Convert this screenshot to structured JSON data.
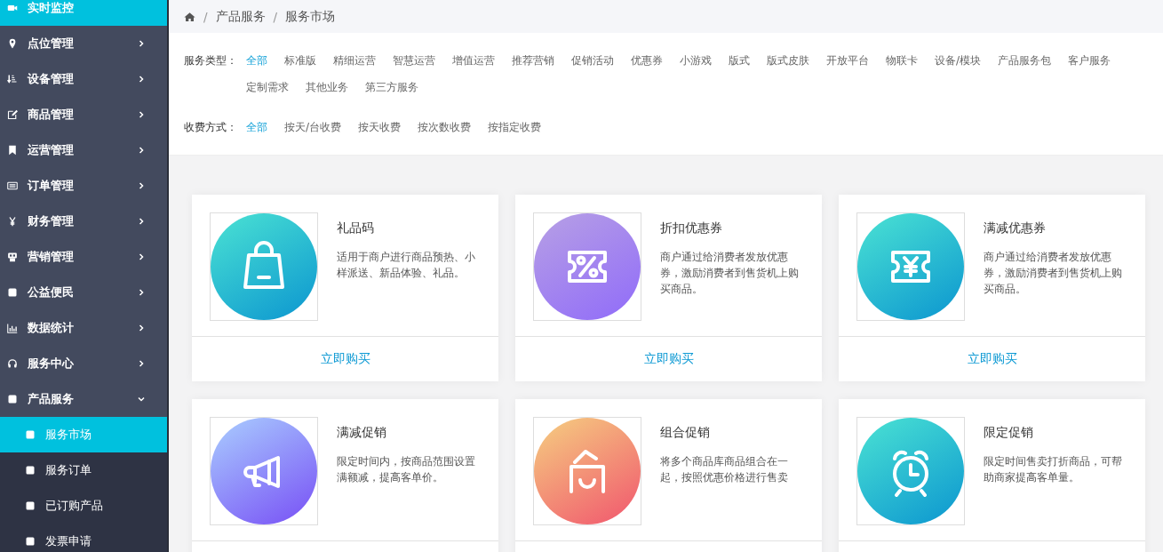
{
  "sidebar": {
    "items": [
      {
        "label": "实时监控",
        "selected": true
      },
      {
        "label": "点位管理",
        "selected": false,
        "expanded": false
      },
      {
        "label": "设备管理",
        "selected": false,
        "expanded": false
      },
      {
        "label": "商品管理",
        "selected": false,
        "expanded": false
      },
      {
        "label": "运营管理",
        "selected": false,
        "expanded": false
      },
      {
        "label": "订单管理",
        "selected": false,
        "expanded": false
      },
      {
        "label": "财务管理",
        "selected": false,
        "expanded": false
      },
      {
        "label": "营销管理",
        "selected": false,
        "expanded": false
      },
      {
        "label": "公益便民",
        "selected": false,
        "expanded": false
      },
      {
        "label": "数据统计",
        "selected": false,
        "expanded": false
      },
      {
        "label": "服务中心",
        "selected": false,
        "expanded": false
      },
      {
        "label": "产品服务",
        "selected": false,
        "expanded": true,
        "children": [
          {
            "label": "服务市场",
            "selected": true
          },
          {
            "label": "服务订单",
            "selected": false
          },
          {
            "label": "已订购产品",
            "selected": false
          },
          {
            "label": "发票申请",
            "selected": false
          }
        ]
      }
    ]
  },
  "breadcrumb": [
    {
      "separator": "/",
      "label": "产品服务"
    },
    {
      "separator": "/",
      "label": "服务市场"
    }
  ],
  "filters": [
    {
      "label": "服务类型：",
      "options": [
        {
          "label": "全部",
          "selected": true
        },
        {
          "label": "标准版",
          "selected": false
        },
        {
          "label": "精细运营",
          "selected": false
        },
        {
          "label": "智慧运营",
          "selected": false
        },
        {
          "label": "增值运营",
          "selected": false
        },
        {
          "label": "推荐营销",
          "selected": false
        },
        {
          "label": "促销活动",
          "selected": false
        },
        {
          "label": "优惠券",
          "selected": false
        },
        {
          "label": "小游戏",
          "selected": false
        },
        {
          "label": "版式",
          "selected": false
        },
        {
          "label": "版式皮肤",
          "selected": false
        },
        {
          "label": "开放平台",
          "selected": false
        },
        {
          "label": "物联卡",
          "selected": false
        },
        {
          "label": "设备/模块",
          "selected": false
        },
        {
          "label": "产品服务包",
          "selected": false
        },
        {
          "label": "客户服务",
          "selected": false
        },
        {
          "label": "定制需求",
          "selected": false
        },
        {
          "label": "其他业务",
          "selected": false
        },
        {
          "label": "第三方服务",
          "selected": false
        }
      ]
    },
    {
      "label": "收费方式：",
      "options": [
        {
          "label": "全部",
          "selected": true
        },
        {
          "label": "按天/台收费",
          "selected": false
        },
        {
          "label": "按天收费",
          "selected": false
        },
        {
          "label": "按次数收费",
          "selected": false
        },
        {
          "label": "按指定收费",
          "selected": false
        }
      ]
    }
  ],
  "cards": [
    {
      "kind": "bag",
      "title": "礼品码",
      "description": "适用于商户进行商品预热、小样派送、新品体验、礼品。",
      "action": "立即购买"
    },
    {
      "kind": "percent-ticket",
      "title": "折扣优惠券",
      "description": "商户通过给消费者发放优惠券，激励消费者到售货机上购买商品。",
      "action": "立即购买"
    },
    {
      "kind": "yen-ticket",
      "title": "满减优惠券",
      "description": "商户通过给消费者发放优惠券，激励消费者到售货机上购买商品。",
      "action": "立即购买"
    },
    {
      "kind": "megaphone",
      "title": "满减促销",
      "description": "限定时间内，按商品范围设置满额减，提高客单价。"
    },
    {
      "kind": "basket",
      "title": "组合促销",
      "description": "将多个商品库商品组合在一起，按照优惠价格进行售卖"
    },
    {
      "kind": "alarm",
      "title": "限定促销",
      "description": "限定时间售卖打折商品，可帮助商家提高客单量。"
    }
  ]
}
